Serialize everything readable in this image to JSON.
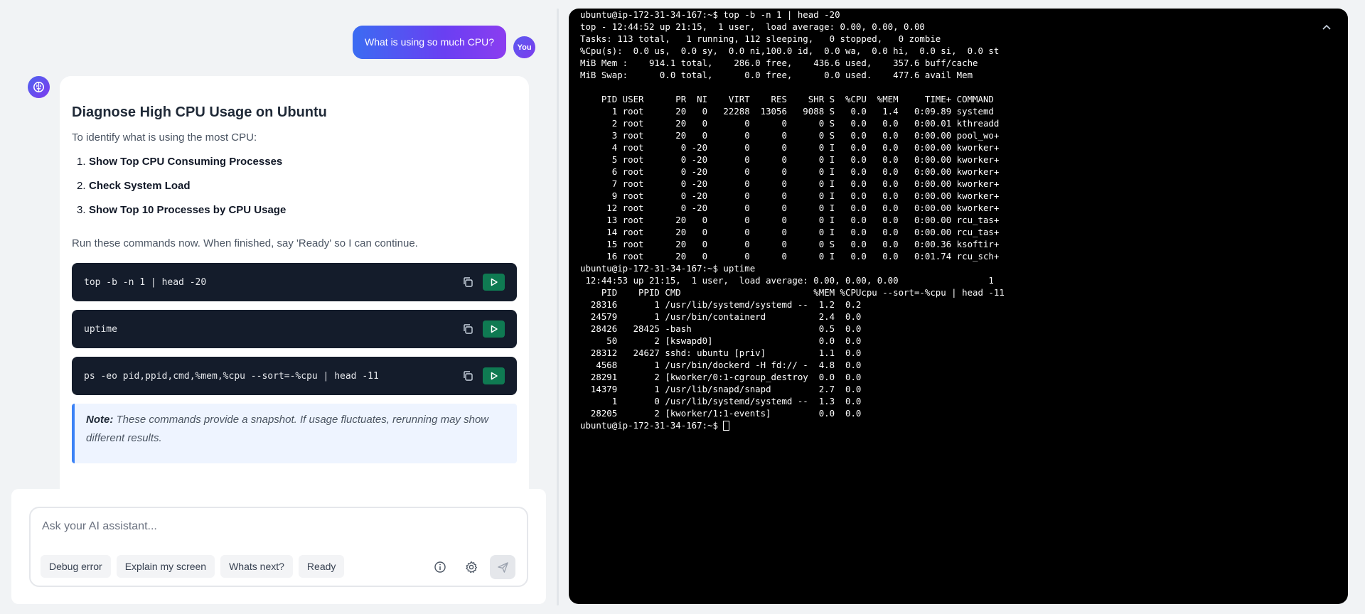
{
  "chat": {
    "user_message": "What is using so much CPU?",
    "user_avatar": "You",
    "assistant": {
      "title": "Diagnose High CPU Usage on Ubuntu",
      "intro": "To identify what is using the most CPU:",
      "steps": [
        {
          "num": "1.",
          "label": "Show Top CPU Consuming Processes"
        },
        {
          "num": "2.",
          "label": "Check System Load"
        },
        {
          "num": "3.",
          "label": "Show Top 10 Processes by CPU Usage"
        }
      ],
      "run_text": "Run these commands now. When finished, say 'Ready' so I can continue.",
      "commands": [
        "top -b -n 1 | head -20",
        "uptime",
        "ps -eo pid,ppid,cmd,%mem,%cpu --sort=-%cpu | head -11"
      ],
      "note_label": "Note:",
      "note_text": "These commands provide a snapshot. If usage fluctuates, rerunning may show different results."
    }
  },
  "input": {
    "placeholder": "Ask your AI assistant...",
    "chips": [
      "Debug error",
      "Explain my screen",
      "Whats next?",
      "Ready"
    ]
  },
  "icons": {
    "assistant": "brain-icon",
    "copy": "copy-icon",
    "run": "play-icon",
    "info": "info-icon",
    "settings": "gear-icon",
    "send": "send-icon",
    "collapse": "chevron-up-icon"
  },
  "colors": {
    "accent_gradient_start": "#3b6cf2",
    "accent_gradient_end": "#8b3df0",
    "code_bg": "#141c2b",
    "run_button": "#0f7a52",
    "note_border": "#3b82f6",
    "terminal_bg": "#000000"
  },
  "terminal": {
    "lines": [
      "ubuntu@ip-172-31-34-167:~$ top -b -n 1 | head -20",
      "top - 12:44:52 up 21:15,  1 user,  load average: 0.00, 0.00, 0.00",
      "Tasks: 113 total,   1 running, 112 sleeping,   0 stopped,   0 zombie",
      "%Cpu(s):  0.0 us,  0.0 sy,  0.0 ni,100.0 id,  0.0 wa,  0.0 hi,  0.0 si,  0.0 st",
      "MiB Mem :    914.1 total,    286.0 free,    436.6 used,    357.6 buff/cache",
      "MiB Swap:      0.0 total,      0.0 free,      0.0 used.    477.6 avail Mem",
      "",
      "    PID USER      PR  NI    VIRT    RES    SHR S  %CPU  %MEM     TIME+ COMMAND",
      "      1 root      20   0   22288  13056   9088 S   0.0   1.4   0:09.89 systemd",
      "      2 root      20   0       0      0      0 S   0.0   0.0   0:00.01 kthreadd",
      "      3 root      20   0       0      0      0 S   0.0   0.0   0:00.00 pool_wo+",
      "      4 root       0 -20       0      0      0 I   0.0   0.0   0:00.00 kworker+",
      "      5 root       0 -20       0      0      0 I   0.0   0.0   0:00.00 kworker+",
      "      6 root       0 -20       0      0      0 I   0.0   0.0   0:00.00 kworker+",
      "      7 root       0 -20       0      0      0 I   0.0   0.0   0:00.00 kworker+",
      "      9 root       0 -20       0      0      0 I   0.0   0.0   0:00.00 kworker+",
      "     12 root       0 -20       0      0      0 I   0.0   0.0   0:00.00 kworker+",
      "     13 root      20   0       0      0      0 I   0.0   0.0   0:00.00 rcu_tas+",
      "     14 root      20   0       0      0      0 I   0.0   0.0   0:00.00 rcu_tas+",
      "     15 root      20   0       0      0      0 S   0.0   0.0   0:00.36 ksoftir+",
      "     16 root      20   0       0      0      0 I   0.0   0.0   0:01.74 rcu_sch+",
      "ubuntu@ip-172-31-34-167:~$ uptime",
      " 12:44:53 up 21:15,  1 user,  load average: 0.00, 0.00, 0.00                 1",
      "    PID    PPID CMD                         %MEM %CPUcpu --sort=-%cpu | head -11",
      "  28316       1 /usr/lib/systemd/systemd --  1.2  0.2",
      "  24579       1 /usr/bin/containerd          2.4  0.0",
      "  28426   28425 -bash                        0.5  0.0",
      "     50       2 [kswapd0]                    0.0  0.0",
      "  28312   24627 sshd: ubuntu [priv]          1.1  0.0",
      "   4568       1 /usr/bin/dockerd -H fd:// -  4.8  0.0",
      "  28291       2 [kworker/0:1-cgroup_destroy  0.0  0.0",
      "  14379       1 /usr/lib/snapd/snapd         2.7  0.0",
      "      1       0 /usr/lib/systemd/systemd --  1.3  0.0",
      "  28205       2 [kworker/1:1-events]         0.0  0.0"
    ],
    "prompt": "ubuntu@ip-172-31-34-167:~$ "
  }
}
